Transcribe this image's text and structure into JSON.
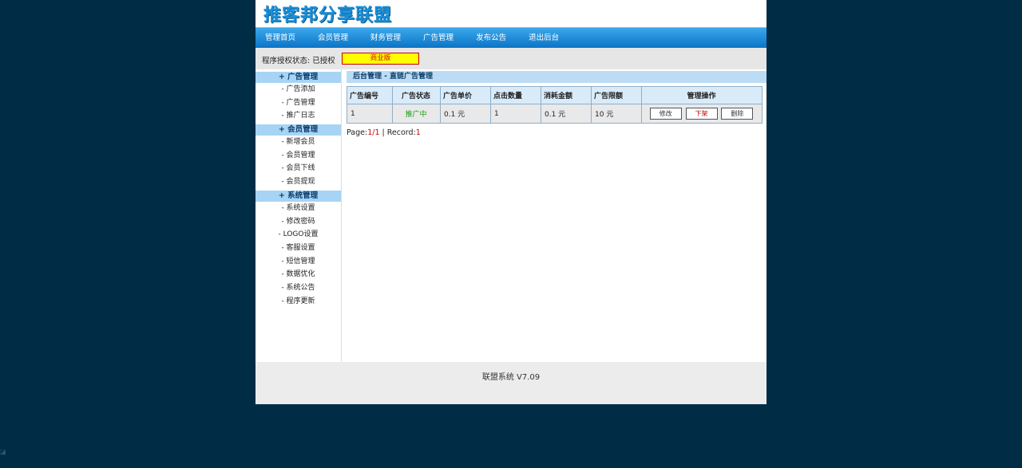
{
  "header": {
    "logo_text": "推客邦分享联盟"
  },
  "nav": {
    "items": [
      "管理首页",
      "会员管理",
      "财务管理",
      "广告管理",
      "发布公告",
      "退出后台"
    ]
  },
  "license": {
    "label": "程序授权状态: 已授权",
    "badge": "商业版"
  },
  "sidebar": {
    "groups": [
      {
        "title": "+ 广告管理",
        "items": [
          "- 广告添加",
          "- 广告管理",
          "- 推广日志"
        ]
      },
      {
        "title": "+ 会员管理",
        "items": [
          "- 新增会员",
          "- 会员管理",
          "- 会员下线",
          "- 会员提现"
        ]
      },
      {
        "title": "+ 系统管理",
        "items": [
          "- 系统设置",
          "- 修改密码",
          "- LOGO设置",
          "- 客服设置",
          "- 短信管理",
          "- 数据优化",
          "- 系统公告",
          "- 程序更新"
        ]
      }
    ]
  },
  "main": {
    "title": "后台管理 - 直链广告管理",
    "table": {
      "headers": [
        "广告编号",
        "广告状态",
        "广告单价",
        "点击数量",
        "消耗金额",
        "广告限额",
        "管理操作"
      ],
      "rows": [
        {
          "id": "1",
          "status": "推广中",
          "price": "0.1 元",
          "clicks": "1",
          "spent": "0.1 元",
          "limit": "10 元",
          "ops": [
            "修改",
            "下架",
            "删除"
          ]
        }
      ]
    },
    "pager": {
      "page_label": "Page:",
      "page_current": "1",
      "page_sep": "/",
      "page_total": "1",
      "record_label": " | Record:",
      "record_count": "1"
    }
  },
  "footer": {
    "text": "联盟系统 V7.09"
  },
  "colors": {
    "background": "#002d45",
    "nav_blue": "#0c74c6",
    "badge_yellow": "#ffff00",
    "status_green": "#1a9a1a"
  }
}
